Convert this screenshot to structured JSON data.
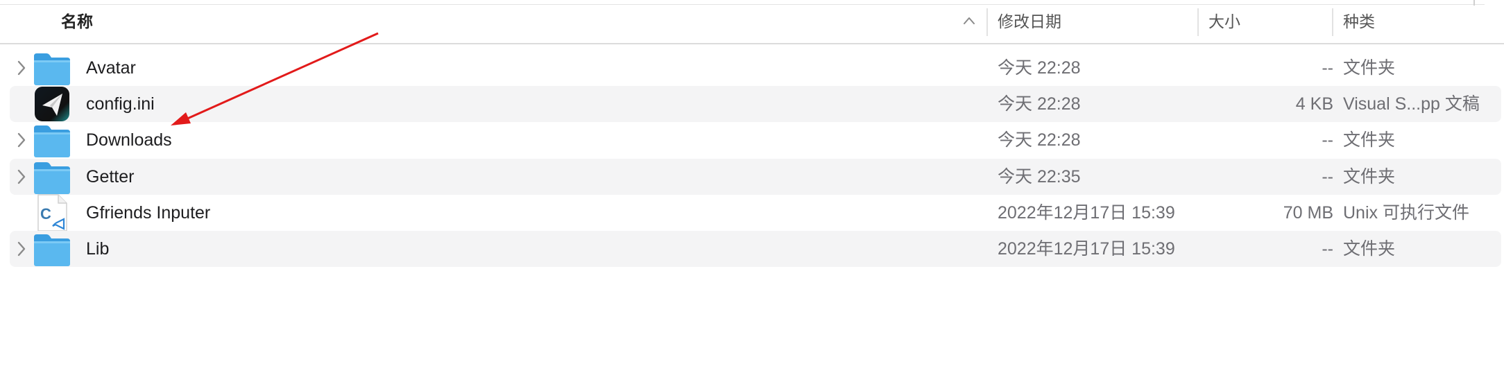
{
  "columns": {
    "name": "名称",
    "date": "修改日期",
    "size": "大小",
    "kind": "种类"
  },
  "icon_names": {
    "sort": "sort-ascending-icon",
    "disclosure": "chevron-right-icon",
    "folder": "folder-icon",
    "config": "paper-plane-app-icon",
    "executable": "c-source-file-icon"
  },
  "colors": {
    "annotation_arrow": "#e21a1a",
    "folder": "#5ab8ef",
    "row_alt": "#f4f4f5"
  },
  "files": [
    {
      "name": "Avatar",
      "date": "今天 22:28",
      "size": "--",
      "kind": "文件夹",
      "type": "folder"
    },
    {
      "name": "config.ini",
      "date": "今天 22:28",
      "size": "4 KB",
      "kind": "Visual S...pp 文稿",
      "type": "config"
    },
    {
      "name": "Downloads",
      "date": "今天 22:28",
      "size": "--",
      "kind": "文件夹",
      "type": "folder"
    },
    {
      "name": "Getter",
      "date": "今天 22:35",
      "size": "--",
      "kind": "文件夹",
      "type": "folder"
    },
    {
      "name": "Gfriends Inputer",
      "date": "2022年12月17日 15:39",
      "size": "70 MB",
      "kind": "Unix 可执行文件",
      "type": "executable"
    },
    {
      "name": "Lib",
      "date": "2022年12月17日 15:39",
      "size": "--",
      "kind": "文件夹",
      "type": "folder"
    }
  ]
}
